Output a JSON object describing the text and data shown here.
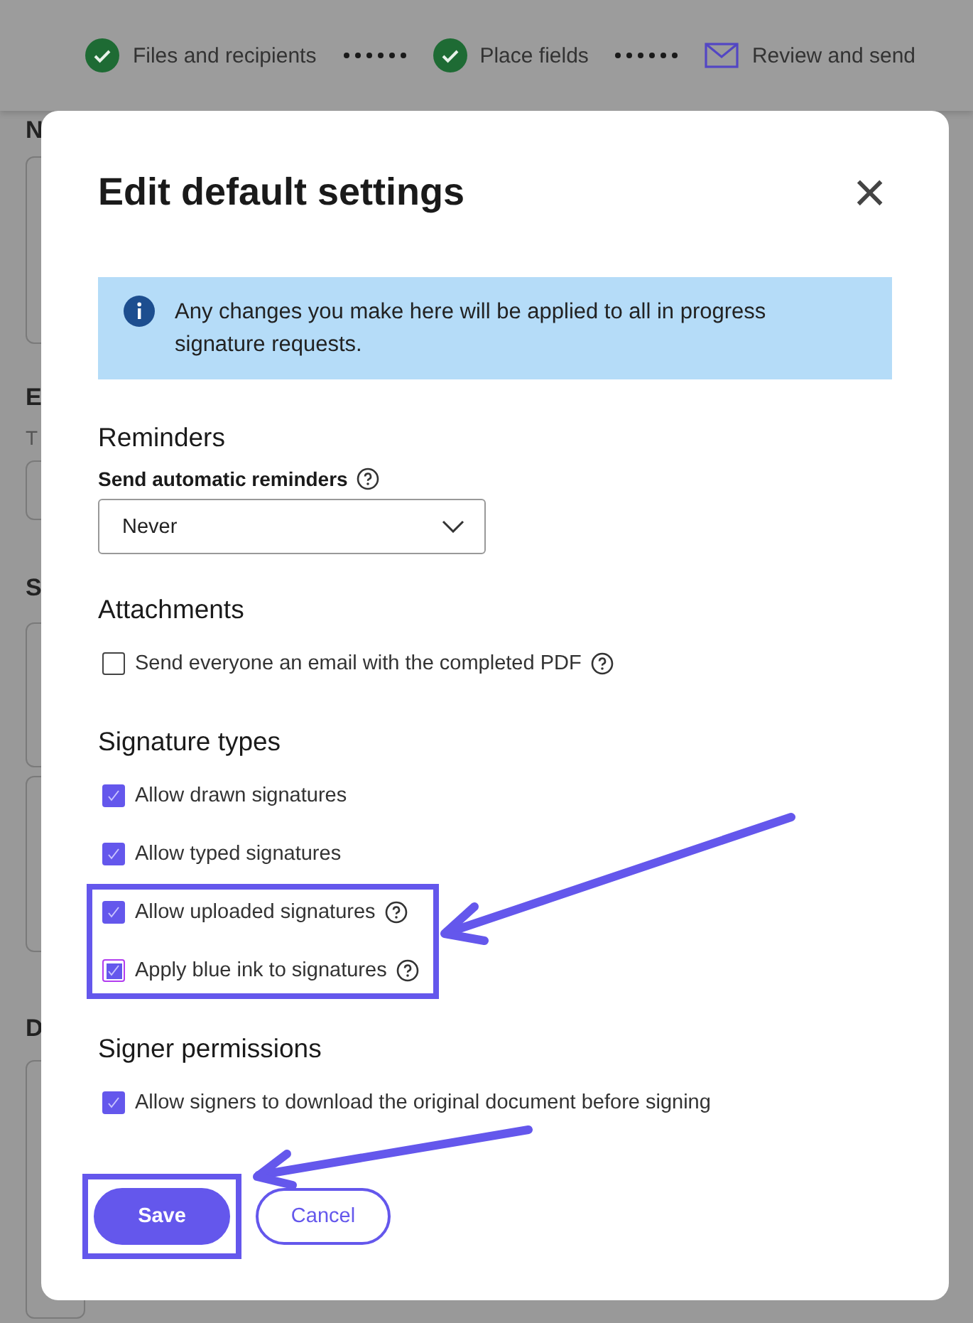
{
  "stepper": {
    "steps": [
      {
        "label": "Files and recipients",
        "kind": "done"
      },
      {
        "label": "Place fields",
        "kind": "done"
      },
      {
        "label": "Review and send",
        "kind": "current"
      }
    ]
  },
  "background_page": {
    "fragments": [
      {
        "kind": "heading",
        "text": "N"
      },
      {
        "kind": "heading",
        "text": "E"
      },
      {
        "kind": "note",
        "text": "T"
      },
      {
        "kind": "heading",
        "text": "S"
      },
      {
        "kind": "heading",
        "text": "D"
      }
    ]
  },
  "dialog": {
    "title": "Edit default settings",
    "close": "×",
    "info": "Any changes you make here will be applied to all in progress signature requests.",
    "sections": [
      {
        "kind": "select",
        "heading": "Reminders",
        "label": "Send automatic reminders",
        "help": true,
        "value": "Never"
      },
      {
        "kind": "checks",
        "heading": "Attachments",
        "options": [
          {
            "label": "Send everyone an email with the completed PDF",
            "checked": false,
            "help": true,
            "focused": false,
            "highlighted": false
          }
        ]
      },
      {
        "kind": "checks",
        "heading": "Signature types",
        "options": [
          {
            "label": "Allow drawn signatures",
            "checked": true,
            "help": false,
            "focused": false,
            "highlighted": false
          },
          {
            "label": "Allow typed signatures",
            "checked": true,
            "help": false,
            "focused": false,
            "highlighted": false
          },
          {
            "label": "Allow uploaded signatures",
            "checked": true,
            "help": true,
            "focused": false,
            "highlighted": true
          },
          {
            "label": "Apply blue ink to signatures",
            "checked": true,
            "help": true,
            "focused": true,
            "highlighted": true
          }
        ]
      },
      {
        "kind": "checks",
        "heading": "Signer permissions",
        "options": [
          {
            "label": "Allow signers to download the original document before signing",
            "checked": true,
            "help": false,
            "focused": false,
            "highlighted": false
          }
        ]
      }
    ],
    "buttons": [
      {
        "label": "Save",
        "kind": "primary",
        "highlighted": true
      },
      {
        "label": "Cancel",
        "kind": "secondary",
        "highlighted": false
      }
    ]
  }
}
